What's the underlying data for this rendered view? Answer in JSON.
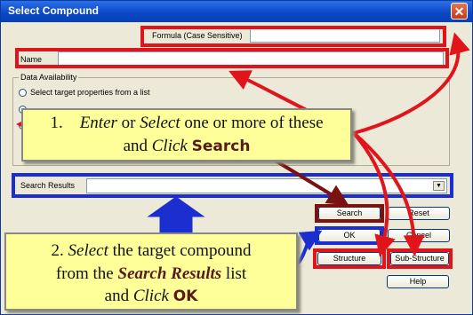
{
  "window": {
    "title": "Select Compound",
    "close_glyph": "✕"
  },
  "fields": {
    "formula_label": "Formula (Case Sensitive)",
    "formula_value": "",
    "name_label": "Name",
    "name_value": "",
    "search_results_label": "Search Results",
    "search_results_value": ""
  },
  "data_availability": {
    "group_label": "Data Availability",
    "options": [
      {
        "label": "Select target properties from a list",
        "selected": false
      },
      {
        "label": "",
        "selected": false
      },
      {
        "label": "",
        "selected": true
      }
    ]
  },
  "buttons": {
    "search": "Search",
    "reset": "Reset",
    "ok": "OK",
    "cancel": "Cancel",
    "structure": "Structure",
    "sub_structure": "Sub-Structure",
    "help": "Help"
  },
  "callout1": {
    "number": "1.",
    "enter": "Enter",
    "or": "or",
    "select": "Select",
    "rest": "one or more of these",
    "and": "and",
    "click": "Click",
    "action": "Search"
  },
  "callout2": {
    "number": "2.",
    "select": "Select",
    "rest1": "the target compound",
    "from_the": "from the",
    "list_name": "Search Results",
    "list": "list",
    "and": "and",
    "click": "Click",
    "action": "OK"
  },
  "colors": {
    "highlight_red": "#e0151c",
    "highlight_blue": "#1b2fd0",
    "highlight_maroon": "#7a1212",
    "callout_fill": "#ffff99"
  }
}
